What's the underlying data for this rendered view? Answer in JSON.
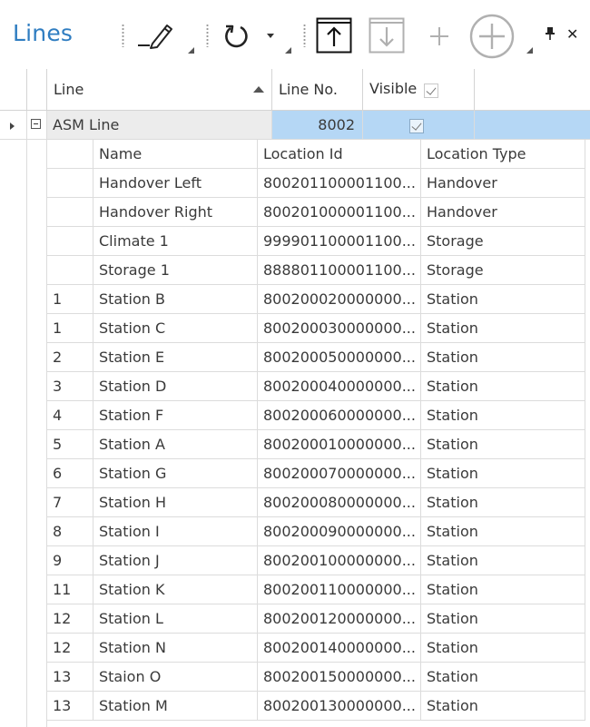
{
  "panel": {
    "title": "Lines",
    "pin_icon": "pin-icon",
    "close_glyph": "✕"
  },
  "toolbar": {
    "edit_icon": "pencil-icon",
    "refresh_icon": "refresh-icon",
    "export_icon": "export-up-icon",
    "import_icon": "import-down-icon",
    "add_icon": "plus-icon",
    "add_circle_icon": "plus-circle-icon"
  },
  "grid": {
    "columns": {
      "line": "Line",
      "line_no": "Line No.",
      "visible": "Visible"
    },
    "master_row": {
      "line": "ASM Line",
      "line_no": "8002",
      "visible": true
    },
    "detail_columns": {
      "seq": "",
      "name": "Name",
      "location_id": "Location Id",
      "location_type": "Location Type"
    },
    "detail_rows": [
      {
        "seq": "",
        "name": "Handover Left",
        "location_id": "800201100001100...",
        "location_type": "Handover"
      },
      {
        "seq": "",
        "name": "Handover Right",
        "location_id": "800201000001100...",
        "location_type": "Handover"
      },
      {
        "seq": "",
        "name": "Climate 1",
        "location_id": "999901100001100...",
        "location_type": "Storage"
      },
      {
        "seq": "",
        "name": "Storage 1",
        "location_id": "888801100001100...",
        "location_type": "Storage"
      },
      {
        "seq": "1",
        "name": "Station B",
        "location_id": "800200020000000...",
        "location_type": "Station"
      },
      {
        "seq": "1",
        "name": "Station C",
        "location_id": "800200030000000...",
        "location_type": "Station"
      },
      {
        "seq": "2",
        "name": "Station E",
        "location_id": "800200050000000...",
        "location_type": "Station"
      },
      {
        "seq": "3",
        "name": "Station D",
        "location_id": "800200040000000...",
        "location_type": "Station"
      },
      {
        "seq": "4",
        "name": "Station F",
        "location_id": "800200060000000...",
        "location_type": "Station"
      },
      {
        "seq": "5",
        "name": "Station A",
        "location_id": "800200010000000...",
        "location_type": "Station"
      },
      {
        "seq": "6",
        "name": "Station G",
        "location_id": "800200070000000...",
        "location_type": "Station"
      },
      {
        "seq": "7",
        "name": "Station H",
        "location_id": "800200080000000...",
        "location_type": "Station"
      },
      {
        "seq": "8",
        "name": "Station I",
        "location_id": "800200090000000...",
        "location_type": "Station"
      },
      {
        "seq": "9",
        "name": "Station J",
        "location_id": "800200100000000...",
        "location_type": "Station"
      },
      {
        "seq": "11",
        "name": "Station K",
        "location_id": "800200110000000...",
        "location_type": "Station"
      },
      {
        "seq": "12",
        "name": "Station L",
        "location_id": "800200120000000...",
        "location_type": "Station"
      },
      {
        "seq": "12",
        "name": "Station N",
        "location_id": "800200140000000...",
        "location_type": "Station"
      },
      {
        "seq": "13",
        "name": "Staion O",
        "location_id": "800200150000000...",
        "location_type": "Station"
      },
      {
        "seq": "13",
        "name": "Station M",
        "location_id": "800200130000000...",
        "location_type": "Station"
      }
    ]
  },
  "colors": {
    "accent": "#2f7dc1",
    "selection": "#b5d7f5",
    "selection_light": "#d9eaf9"
  }
}
